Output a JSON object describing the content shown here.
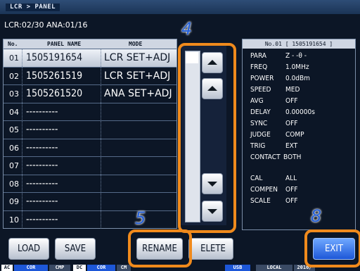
{
  "window": {
    "title": "LCR > PANEL"
  },
  "status_line": "LCR:02/30  ANA:01/16",
  "table": {
    "headers": {
      "no": "No.",
      "name": "PANEL NAME",
      "mode": "MODE"
    },
    "rows": [
      {
        "no": "01",
        "name": "1505191654",
        "mode": "LCR SET+ADJ",
        "selected": true
      },
      {
        "no": "02",
        "name": "1505261519",
        "mode": "LCR SET+ADJ"
      },
      {
        "no": "03",
        "name": "1505261520",
        "mode": "ANA SET+ADJ"
      },
      {
        "no": "04",
        "name": "----------",
        "mode": ""
      },
      {
        "no": "05",
        "name": "----------",
        "mode": ""
      },
      {
        "no": "06",
        "name": "----------",
        "mode": ""
      },
      {
        "no": "07",
        "name": "----------",
        "mode": ""
      },
      {
        "no": "08",
        "name": "----------",
        "mode": ""
      },
      {
        "no": "09",
        "name": "----------",
        "mode": ""
      },
      {
        "no": "10",
        "name": "----------",
        "mode": ""
      }
    ]
  },
  "info": {
    "title": "No.01 [ 1505191654 ]",
    "params": [
      {
        "key": "PARA",
        "value": "Z  -  -θ  -"
      },
      {
        "key": "FREQ",
        "value": "      1.0MHz"
      },
      {
        "key": "POWER",
        "value": "0.0dBm"
      },
      {
        "key": "SPEED",
        "value": "MED"
      },
      {
        "key": "AVG",
        "value": "OFF"
      },
      {
        "key": "DELAY",
        "value": "0.00000s"
      },
      {
        "key": "SYNC",
        "value": "OFF"
      },
      {
        "key": "JUDGE",
        "value": "COMP"
      },
      {
        "key": "TRIG",
        "value": "EXT"
      },
      {
        "key": "CONTACT",
        "value": "BOTH"
      },
      {
        "key": "CAL",
        "value": "ALL"
      },
      {
        "key": "COMPEN",
        "value": "OFF"
      },
      {
        "key": "SCALE",
        "value": "OFF"
      }
    ]
  },
  "buttons": {
    "load": "LOAD",
    "save": "SAVE",
    "rename": "RENAME",
    "delete": "ELETE",
    "exit": "EXIT"
  },
  "bottom_bar": {
    "ac": "AC",
    "cor1": "COR",
    "cmp": "CMP",
    "dc": "DC",
    "cor2": "COR",
    "cm": "CM",
    "usb": "USB",
    "local": "LOCAL",
    "year": "2016/"
  },
  "annotations": {
    "a4": "4",
    "a5": "5",
    "a8": "8"
  },
  "colors": {
    "annotation_border": "#f08a1c",
    "annotation_number": "#2560d8",
    "screen_bg": "#0c1626",
    "exit_button": "#1d57d8"
  }
}
